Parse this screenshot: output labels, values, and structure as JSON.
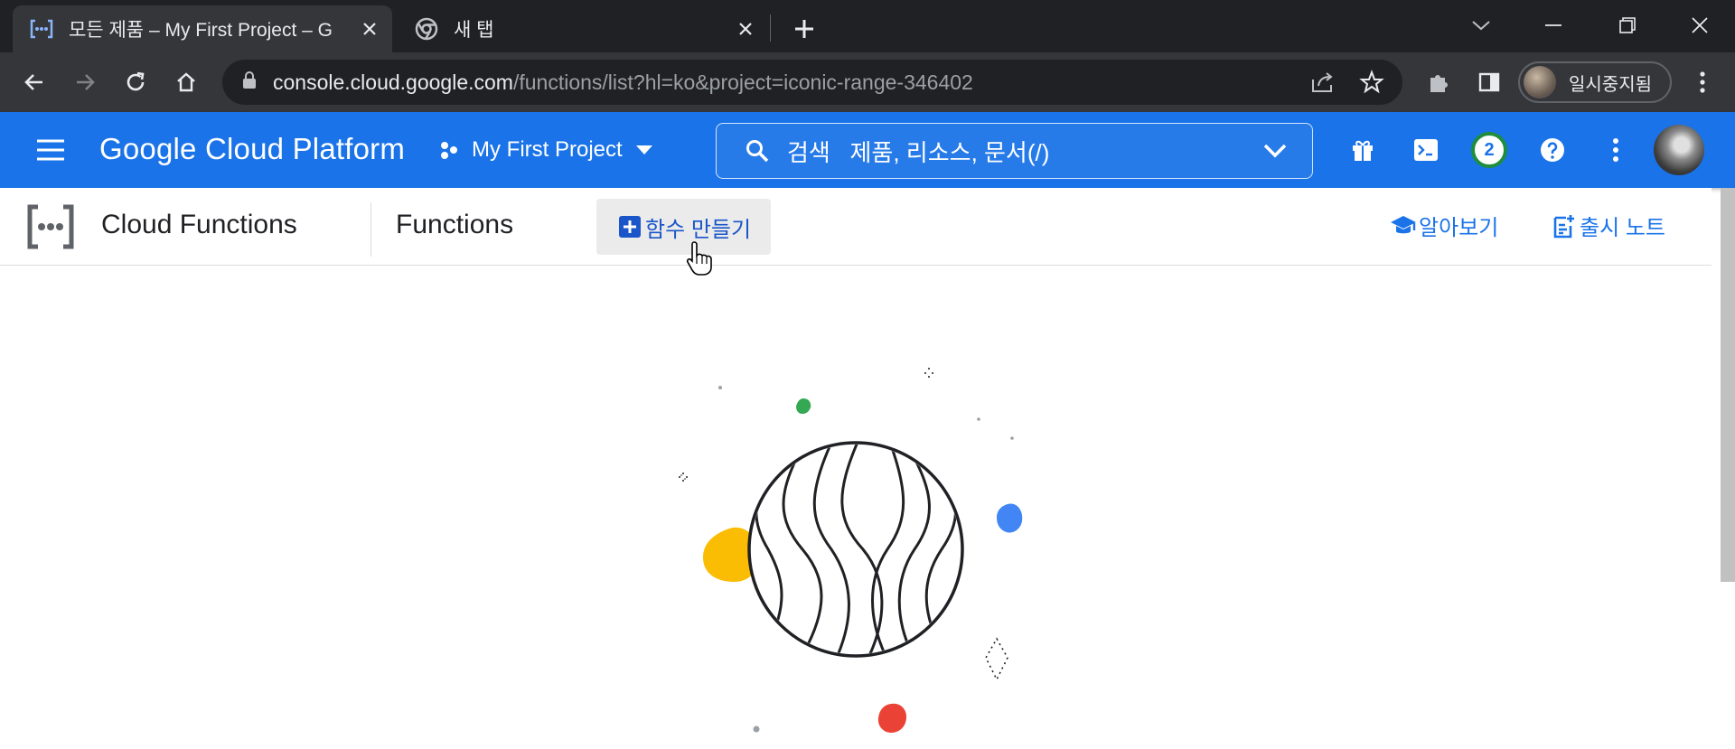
{
  "browser": {
    "tabs": [
      {
        "title": "모든 제품 – My First Project – G",
        "active": true
      },
      {
        "title": "새 탭",
        "active": false
      }
    ],
    "address": {
      "host": "console.cloud.google.com",
      "path": "/functions/list?hl=ko&project=iconic-range-346402"
    },
    "profile_label": "일시중지됨"
  },
  "header": {
    "app_title": "Google Cloud Platform",
    "project_name": "My First Project",
    "search_label": "검색",
    "search_placeholder": "제품, 리소스, 문서(/)",
    "notification_count": "2"
  },
  "subheader": {
    "product_name": "Cloud Functions",
    "page_title": "Functions",
    "create_button": "함수 만들기",
    "learn_link": "알아보기",
    "release_notes_link": "출시 노트"
  },
  "colors": {
    "brand_blue": "#1a73e8",
    "titlebar": "#202124",
    "toolbar": "#35363a",
    "illus_yellow": "#fbbc04",
    "illus_blue": "#4285f4",
    "illus_red": "#ea4335",
    "illus_green": "#34a853"
  },
  "icons": [
    "cloud-functions-icon",
    "chrome-icon",
    "close-icon",
    "plus-icon",
    "back-arrow-icon",
    "forward-arrow-icon",
    "reload-icon",
    "home-icon",
    "lock-icon",
    "share-icon",
    "star-icon",
    "extensions-icon",
    "side-panel-icon",
    "menu-icon",
    "project-icon",
    "search-icon",
    "gift-icon",
    "terminal-icon",
    "help-icon",
    "more-vert-icon",
    "school-icon",
    "release-notes-icon"
  ]
}
